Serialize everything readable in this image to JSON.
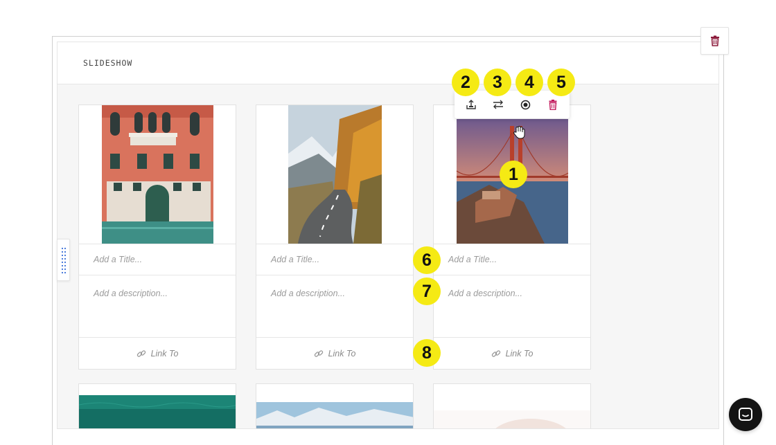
{
  "panel": {
    "title": "SLIDESHOW"
  },
  "slides": [
    {
      "title_placeholder": "Add a Title...",
      "description_placeholder": "Add a description...",
      "link_label": "Link To"
    },
    {
      "title_placeholder": "Add a Title...",
      "description_placeholder": "Add a description...",
      "link_label": "Link To"
    },
    {
      "title_placeholder": "Add a Title...",
      "description_placeholder": "Add a description...",
      "link_label": "Link To"
    }
  ],
  "toolbar": {
    "icons": [
      "upload-icon",
      "swap-icon",
      "focus-point-icon",
      "trash-icon"
    ],
    "accent": "#c2185b"
  },
  "annotations": [
    "1",
    "2",
    "3",
    "4",
    "5",
    "6",
    "7",
    "8"
  ],
  "colors": {
    "badge": "#f5ea14",
    "delete": "#8b1a3a",
    "chat": "#141414"
  }
}
